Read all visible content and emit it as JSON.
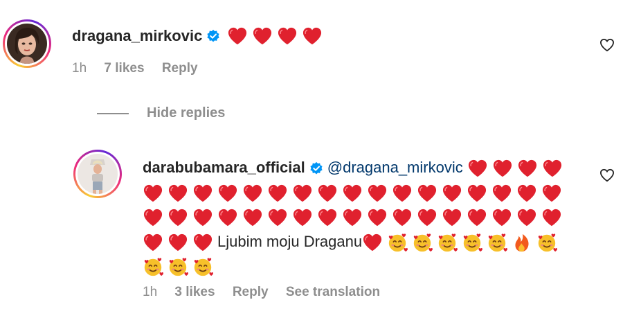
{
  "comment": {
    "username": "dragana_mirkovic",
    "heart_count": 4,
    "time": "1h",
    "likes": "7 likes",
    "reply_label": "Reply"
  },
  "replies_toggle": {
    "label": "Hide replies"
  },
  "reply": {
    "username": "darabubamara_official",
    "mention": "@dragana_mirkovic",
    "message": "Ljubim moju Draganu",
    "time": "1h",
    "likes": "3 likes",
    "reply_label": "Reply",
    "translate_label": "See translation",
    "emoji_sequence_before_text": 41,
    "emoji_sequence_after_text": [
      "heart",
      "smiling-face-with-hearts",
      "smiling-face-with-hearts",
      "smiling-face-with-hearts",
      "smiling-face-with-hearts",
      "smiling-face-with-hearts",
      "fire",
      "smiling-face-with-hearts",
      "smiling-face-with-hearts",
      "smiling-face-with-hearts",
      "smiling-face-with-hearts"
    ]
  },
  "colors": {
    "heart": "#e0212e",
    "verified": "#0095f6",
    "meta": "#8e8e8e",
    "mention": "#00376b",
    "text": "#262626"
  }
}
